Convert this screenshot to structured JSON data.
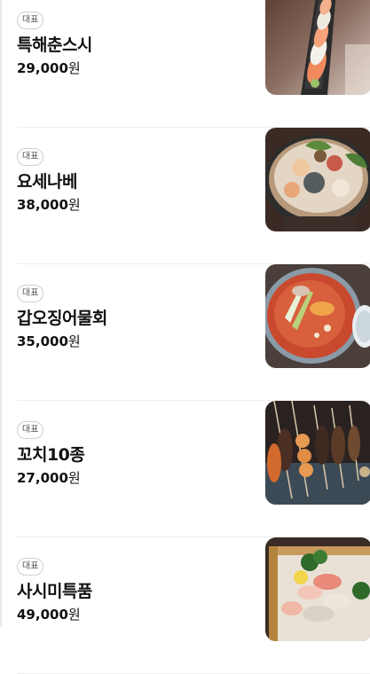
{
  "menu": {
    "items": [
      {
        "badge": "대표",
        "name": "특해춘스시",
        "price_number": "29,000",
        "price_unit": "원",
        "image": "sushi-platter-image"
      },
      {
        "badge": "대표",
        "name": "요세나베",
        "price_number": "38,000",
        "price_unit": "원",
        "image": "seafood-hotpot-image"
      },
      {
        "badge": "대표",
        "name": "갑오징어물회",
        "price_number": "35,000",
        "price_unit": "원",
        "image": "squid-cold-soup-image"
      },
      {
        "badge": "대표",
        "name": "꼬치10종",
        "price_number": "27,000",
        "price_unit": "원",
        "image": "skewers-image"
      },
      {
        "badge": "대표",
        "name": "사시미특품",
        "price_number": "49,000",
        "price_unit": "원",
        "image": "sashimi-platter-image"
      }
    ]
  },
  "colors": {
    "badge_border": "#cfcfcf",
    "divider": "#eeeeee",
    "text": "#111111"
  }
}
